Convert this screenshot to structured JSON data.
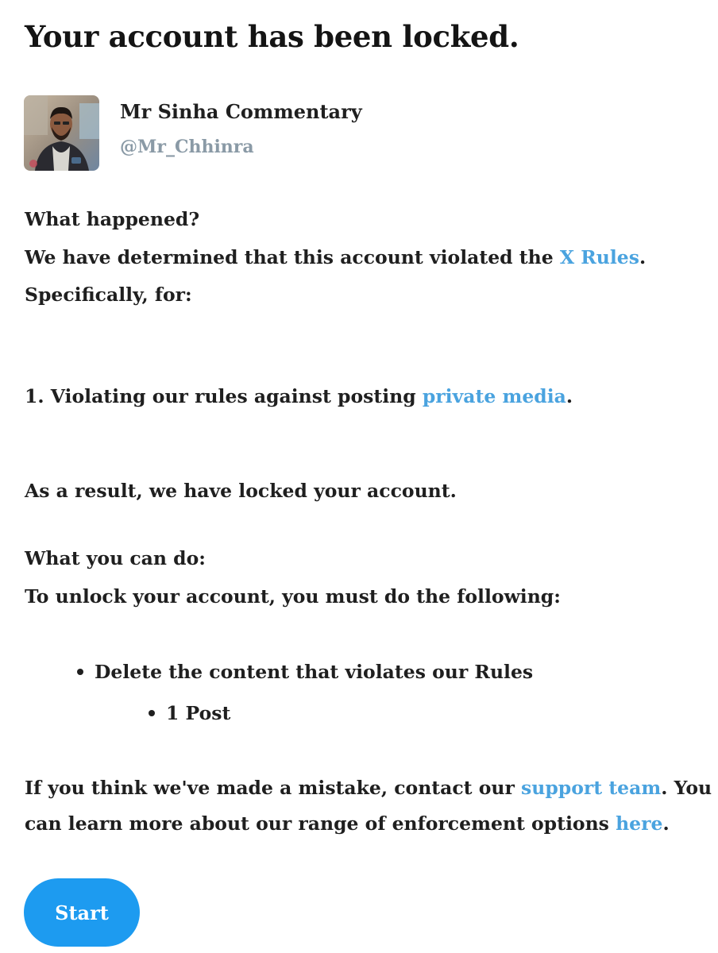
{
  "title": "Your account has been locked.",
  "profile": {
    "display_name": "Mr Sinha Commentary",
    "handle": "@Mr_Chhinra"
  },
  "what_happened": {
    "heading": "What happened?",
    "line_prefix": "We have determined that this account violated the ",
    "rules_link": "X Rules",
    "line_suffix": ".",
    "specifically": "Specifically, for:"
  },
  "violation": {
    "prefix": "1. Violating our rules against posting ",
    "link": "private media",
    "suffix": "."
  },
  "result": "As a result, we have locked your account.",
  "what_you_can_do": {
    "heading": "What you can do:",
    "instruction": "To unlock your account, you must do the following:",
    "bullet": "Delete the content that violates our Rules",
    "sub_bullet": "1 Post"
  },
  "footer": {
    "line1_prefix": "If you think we've made a mistake, contact our ",
    "support_link": "support team",
    "line1_suffix": ". You",
    "line2_prefix": "can learn more about our range of enforcement options ",
    "here_link": "here",
    "line2_suffix": "."
  },
  "start_button": "Start",
  "colors": {
    "link": "#4aa3df",
    "button": "#1d9bf0",
    "handle": "#8a9aa6"
  }
}
